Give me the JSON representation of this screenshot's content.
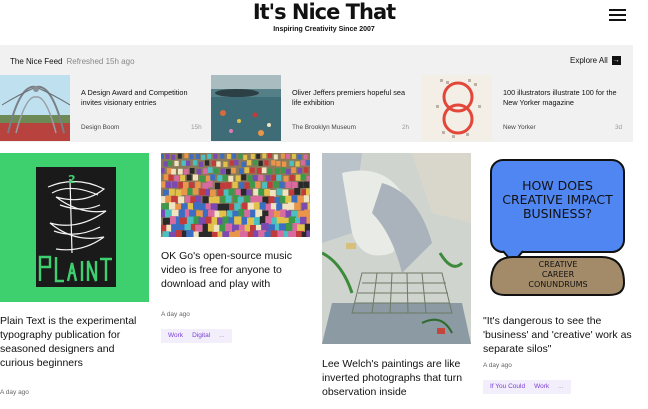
{
  "header": {
    "logo": "It's Nice That",
    "tagline": "Inspiring Creativity Since 2007"
  },
  "feed": {
    "title": "The Nice Feed",
    "refreshed": "Refreshed 15h ago",
    "explore_label": "Explore All",
    "items": [
      {
        "text": "A Design Award and Competition invites visionary entries",
        "source": "Design Boom",
        "age": "15h"
      },
      {
        "text": "Oliver Jeffers premiers hopeful sea life exhibition",
        "source": "The Brooklyn Museum",
        "age": "2h"
      },
      {
        "text": "100 illustrators illustrate 100 for the New Yorker magazine",
        "source": "New Yorker",
        "age": "3d"
      }
    ]
  },
  "cards": [
    {
      "title": "Plain Text is the experimental typography publication for seasoned designers and curious beginners",
      "date": "A day ago",
      "tags": []
    },
    {
      "title": "OK Go's open-source music video is free for anyone to download and play with",
      "date": "A day ago",
      "tags": [
        "Work",
        "Digital",
        "..."
      ]
    },
    {
      "title": "Lee Welch's paintings are like inverted photographs that turn observation inside",
      "date": "",
      "tags": []
    },
    {
      "title": "\"It's dangerous to see the 'business' and 'creative' work as separate silos\"",
      "date": "A day ago",
      "tags": [
        "If You Could",
        "Work",
        "..."
      ],
      "poster": {
        "headline": "HOW DOES CREATIVE IMPACT BUSINESS?",
        "sub": "CREATIVE CAREER CONUNDRUMS"
      }
    }
  ],
  "colors": {
    "feed_bg": "#f1f1f1",
    "tag_text": "#7a3fd6",
    "tag_bg": "#f3eefb",
    "plain_text_green": "#3ecf6e",
    "poster_blue": "#4f86f2",
    "poster_brown": "#a38b6a"
  }
}
